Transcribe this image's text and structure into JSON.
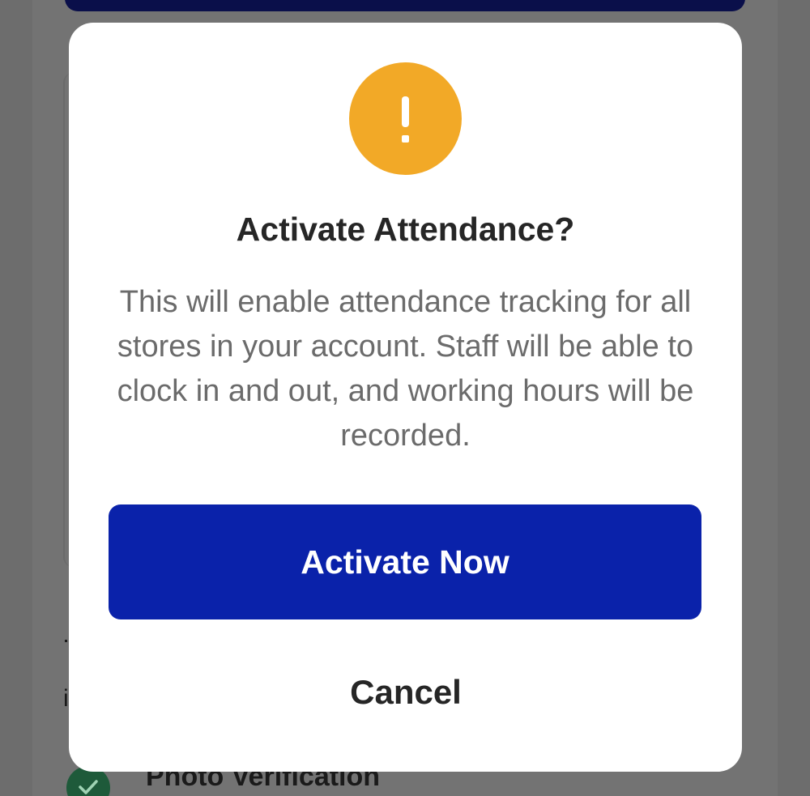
{
  "background": {
    "list_item_label": "Photo Verification",
    "partial_glyph": "i",
    "check_icon": "check-circle-icon"
  },
  "dialog": {
    "icon": "exclamation-icon",
    "title": "Activate Attendance?",
    "message": "This will enable attendance tracking for all stores in your account. Staff will be able to clock in and out, and working hours will be recorded.",
    "primary_label": "Activate Now",
    "secondary_label": "Cancel"
  },
  "colors": {
    "overlay": "#737373",
    "icon_bg": "#f2a927",
    "primary_button": "#0a22aa",
    "header_bar": "#0a0f4a",
    "check_bg": "#1e5a3a"
  }
}
